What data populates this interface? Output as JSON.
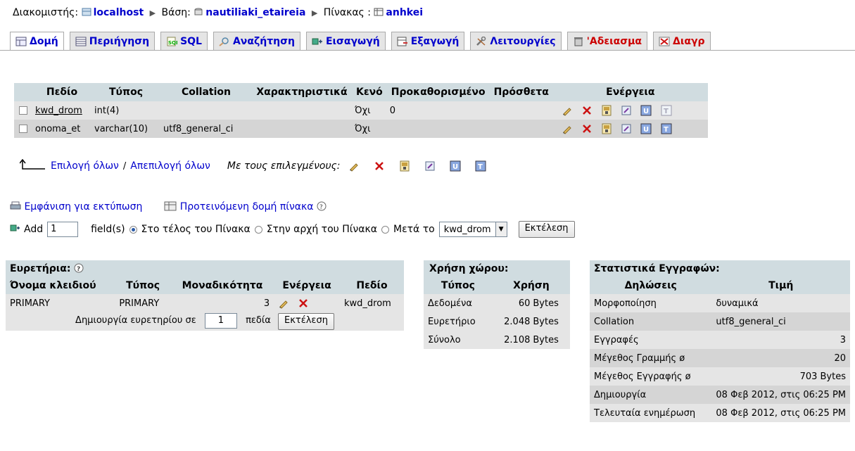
{
  "breadcrumb": {
    "server_label": "Διακομιστής:",
    "server": "localhost",
    "db_label": "Βάση:",
    "db": "nautiliaki_etaireia",
    "table_label": "Πίνακας :",
    "table": "anhkei"
  },
  "tabs": [
    {
      "label": "Δομή",
      "icon": "structure-icon",
      "active": true
    },
    {
      "label": "Περιήγηση",
      "icon": "browse-icon"
    },
    {
      "label": "SQL",
      "icon": "sql-icon"
    },
    {
      "label": "Αναζήτηση",
      "icon": "search-icon"
    },
    {
      "label": "Εισαγωγή",
      "icon": "insert-icon"
    },
    {
      "label": "Εξαγωγή",
      "icon": "export-icon"
    },
    {
      "label": "Λειτουργίες",
      "icon": "operations-icon"
    },
    {
      "label": "'Αδειασμα",
      "icon": "empty-icon",
      "red": true
    },
    {
      "label": "Διαγρ",
      "icon": "drop-icon",
      "red": true
    }
  ],
  "fields_table": {
    "headers": [
      "Πεδίο",
      "Τύπος",
      "Collation",
      "Χαρακτηριστικά",
      "Κενό",
      "Προκαθορισμένο",
      "Πρόσθετα",
      "Ενέργεια"
    ],
    "rows": [
      {
        "field": "kwd_drom",
        "type": "int(4)",
        "collation": "",
        "attributes": "",
        "null": "Όχι",
        "default": "0",
        "extra": ""
      },
      {
        "field": "onoma_et",
        "type": "varchar(10)",
        "collation": "utf8_general_ci",
        "attributes": "",
        "null": "Όχι",
        "default": "",
        "extra": ""
      }
    ]
  },
  "selection": {
    "check_all": "Επιλογή όλων",
    "separator": "/",
    "uncheck_all": "Απεπιλογή όλων",
    "with_selected": "Με τους επιλεγμένους:"
  },
  "links": {
    "print_view": "Εμφάνιση για εκτύπωση",
    "propose_structure": "Προτεινόμενη δομή πίνακα"
  },
  "add_field": {
    "add_label": "Add",
    "count": "1",
    "fields_label": "field(s)",
    "opt_end": "Στο τέλος του Πίνακα",
    "opt_begin": "Στην αρχή του Πίνακα",
    "opt_after": "Μετά το",
    "after_field": "kwd_drom",
    "go": "Εκτέλεση"
  },
  "indexes": {
    "title": "Ευρετήρια:",
    "headers": [
      "Όνομα κλειδιού",
      "Τύπος",
      "Μοναδικότητα",
      "Ενέργεια",
      "Πεδίο"
    ],
    "rows": [
      {
        "key": "PRIMARY",
        "type": "PRIMARY",
        "cardinality": "3",
        "field": "kwd_drom"
      }
    ],
    "create_label": "Δημιουργία ευρετηρίου σε",
    "create_count": "1",
    "columns_label": "πεδία",
    "go": "Εκτέλεση"
  },
  "space": {
    "title": "Χρήση χώρου:",
    "headers": [
      "Τύπος",
      "Χρήση"
    ],
    "rows": [
      {
        "type": "Δεδομένα",
        "value": "60",
        "unit": "Bytes"
      },
      {
        "type": "Ευρετήριο",
        "value": "2.048",
        "unit": "Bytes"
      },
      {
        "type": "Σύνολο",
        "value": "2.108",
        "unit": "Bytes"
      }
    ]
  },
  "stats": {
    "title": "Στατιστικά Εγγραφών:",
    "headers": [
      "Δηλώσεις",
      "Τιμή"
    ],
    "rows": [
      {
        "label": "Μορφοποίηση",
        "value": "δυναμικά",
        "align": "left"
      },
      {
        "label": "Collation",
        "value": "utf8_general_ci",
        "align": "left"
      },
      {
        "label": "Εγγραφές",
        "value": "3",
        "align": "right"
      },
      {
        "label": "Μέγεθος Γραμμής ø",
        "value": "20",
        "align": "right"
      },
      {
        "label": "Μέγεθος Εγγραφής  ø",
        "value": "703 Bytes",
        "align": "right"
      },
      {
        "label": "Δημιουργία",
        "value": "08 Φεβ 2012, στις 06:25 PM",
        "align": "left",
        "small": true
      },
      {
        "label": "Τελευταία ενημέρωση",
        "value": "08 Φεβ 2012, στις 06:25 PM",
        "align": "left",
        "small": true
      }
    ]
  },
  "colors": {
    "link": "#0000cc",
    "header_bg": "#d0dce0",
    "row_a": "#e5e5e5",
    "row_b": "#d5d5d5",
    "danger": "#cc0000"
  }
}
